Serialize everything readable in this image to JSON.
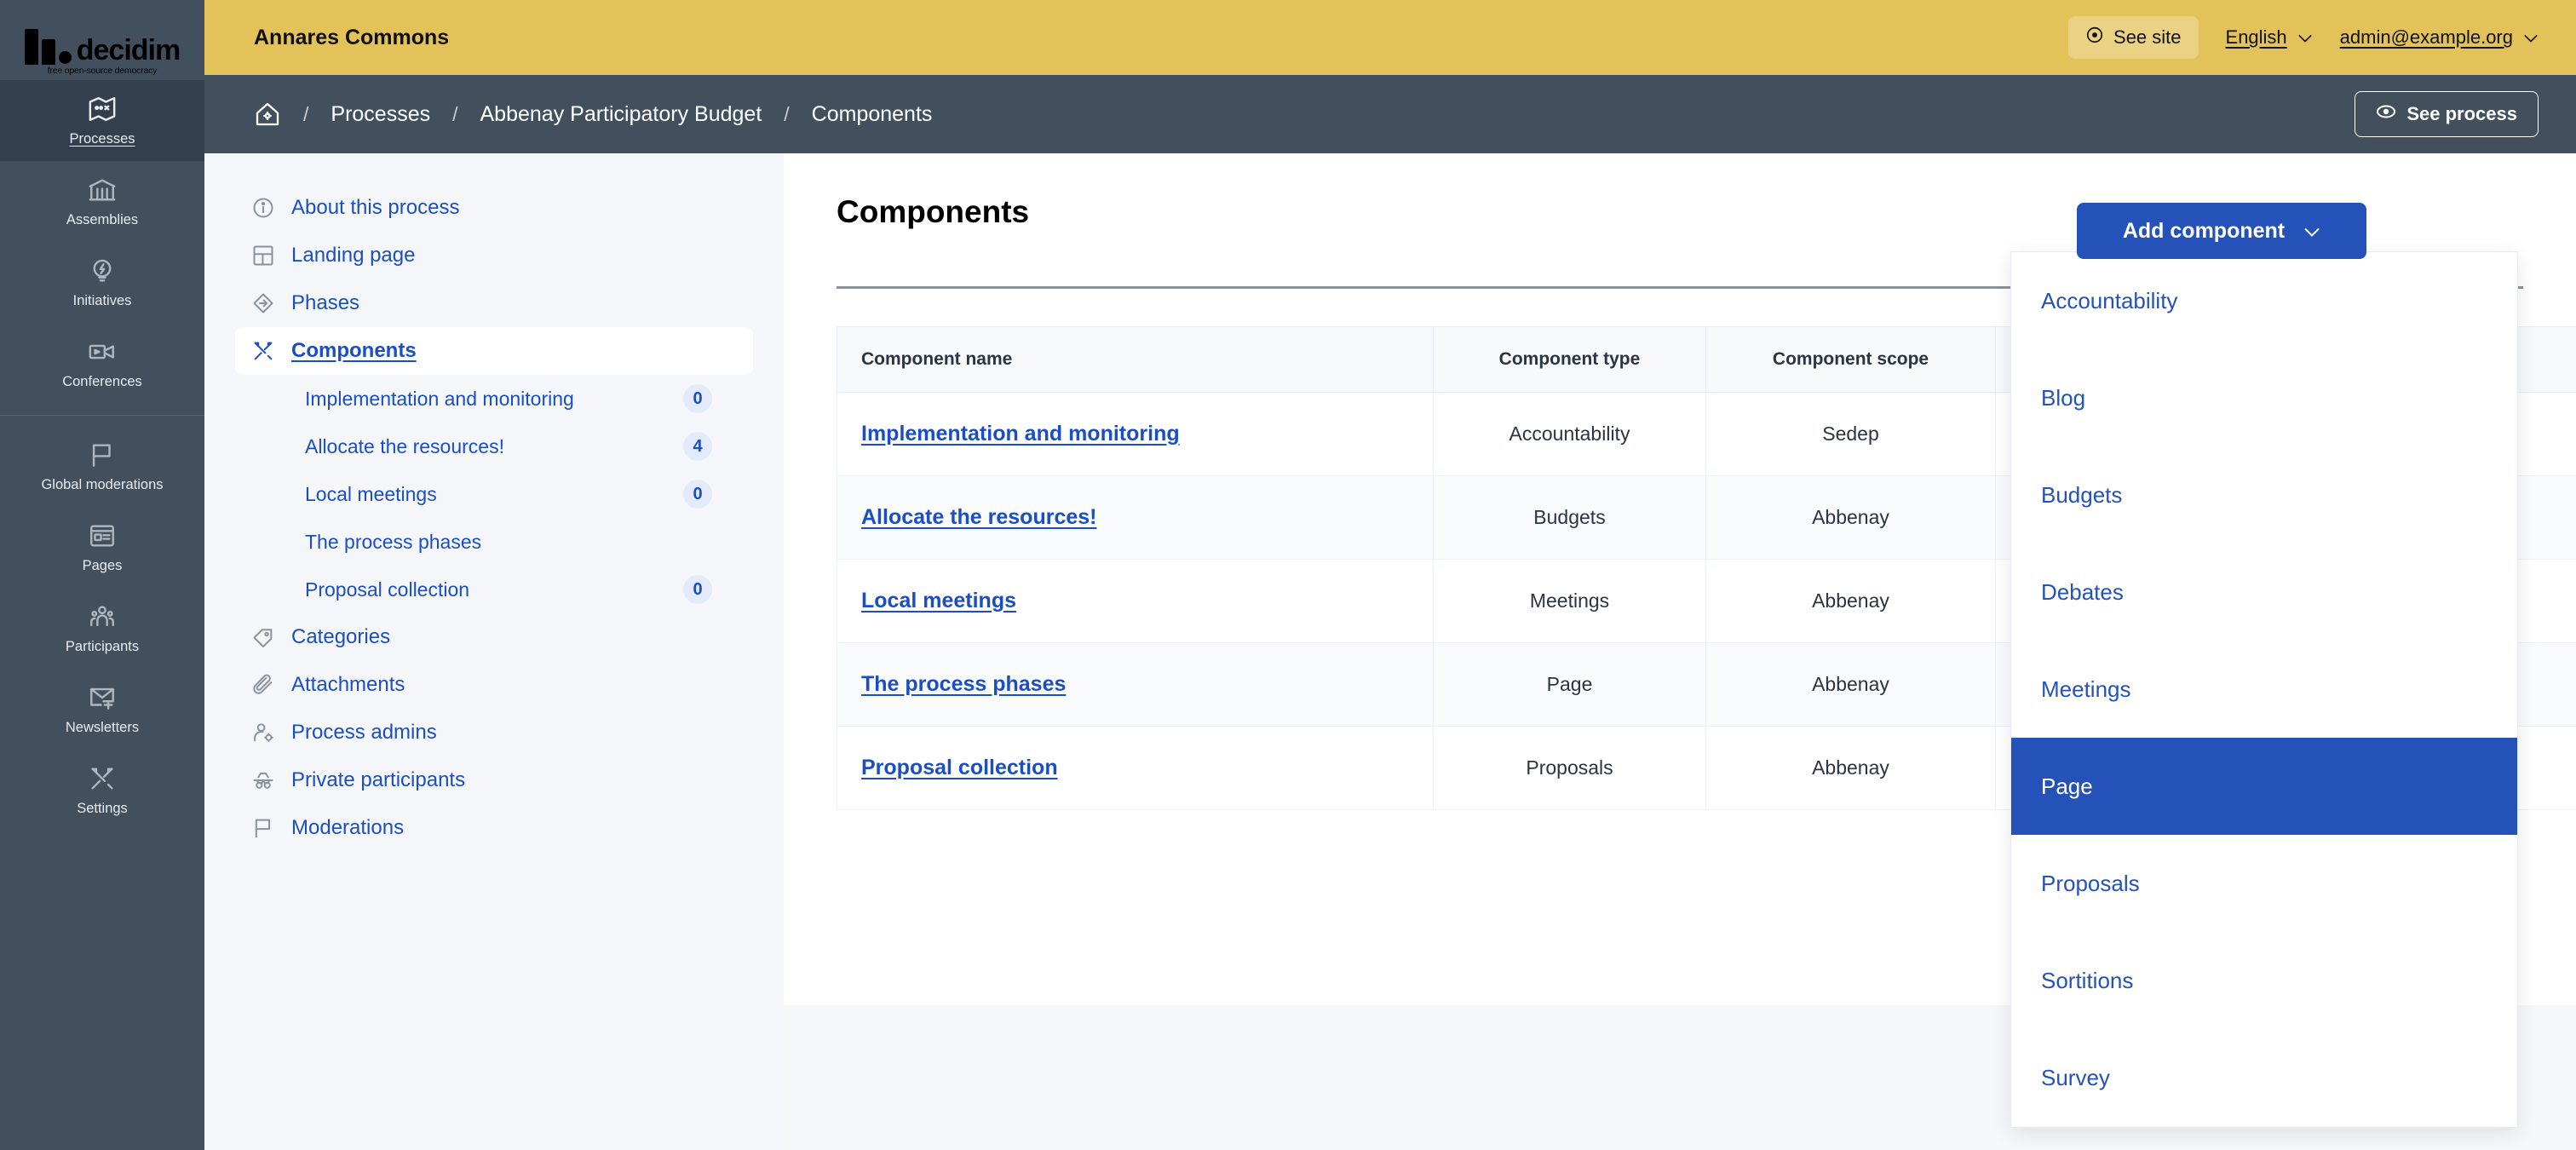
{
  "brand": {
    "logo_word": "decidim",
    "logo_tagline": "free open-source democracy"
  },
  "topbar": {
    "organization_title": "Annares Commons",
    "see_site_label": "See site",
    "see_site_icon": "eye-icon",
    "language_label": "English",
    "language_caret_icon": "chevron-down-icon",
    "account_label": "admin@example.org",
    "account_caret_icon": "chevron-down-icon"
  },
  "breadcrumb": {
    "home_icon": "home-icon",
    "separator": "/",
    "items": [
      {
        "label": "Processes"
      },
      {
        "label": "Abbenay Participatory Budget"
      },
      {
        "label": "Components"
      }
    ],
    "see_process_label": "See process",
    "see_process_icon": "eye-icon"
  },
  "admin_rail": {
    "groups": [
      {
        "items": [
          {
            "label": "Processes",
            "icon": "map-icon",
            "active": true
          },
          {
            "label": "Assemblies",
            "icon": "government-icon",
            "active": false
          },
          {
            "label": "Initiatives",
            "icon": "lightbulb-icon",
            "active": false
          },
          {
            "label": "Conferences",
            "icon": "video-camera-icon",
            "active": false
          }
        ]
      },
      {
        "items": [
          {
            "label": "Global moderations",
            "icon": "flag-icon",
            "active": false
          },
          {
            "label": "Pages",
            "icon": "article-icon",
            "active": false
          },
          {
            "label": "Participants",
            "icon": "people-icon",
            "active": false
          },
          {
            "label": "Newsletters",
            "icon": "mail-add-icon",
            "active": false
          },
          {
            "label": "Settings",
            "icon": "tools-icon",
            "active": false
          }
        ]
      }
    ]
  },
  "process_nav": {
    "items": [
      {
        "label": "About this process",
        "icon": "info-circle-icon",
        "current": false
      },
      {
        "label": "Landing page",
        "icon": "layout-grid-icon",
        "current": false
      },
      {
        "label": "Phases",
        "icon": "diamond-arrow-icon",
        "current": false
      },
      {
        "label": "Components",
        "icon": "tools-icon",
        "current": true
      }
    ],
    "sub_items": [
      {
        "label": "Implementation and monitoring",
        "count": "0",
        "has_count": true
      },
      {
        "label": "Allocate the resources!",
        "count": "4",
        "has_count": true
      },
      {
        "label": "Local meetings",
        "count": "0",
        "has_count": true
      },
      {
        "label": "The process phases",
        "count": "",
        "has_count": false
      },
      {
        "label": "Proposal collection",
        "count": "0",
        "has_count": true
      }
    ],
    "tail_items": [
      {
        "label": "Categories",
        "icon": "tag-icon"
      },
      {
        "label": "Attachments",
        "icon": "paperclip-icon"
      },
      {
        "label": "Process admins",
        "icon": "user-settings-icon"
      },
      {
        "label": "Private participants",
        "icon": "spy-icon"
      },
      {
        "label": "Moderations",
        "icon": "flag-icon"
      }
    ]
  },
  "main": {
    "title": "Components",
    "add_component_label": "Add component",
    "add_component_caret_icon": "chevron-down-icon",
    "table": {
      "headers": [
        "Component name",
        "Component type",
        "Component scope",
        ""
      ],
      "rows": [
        {
          "name": "Implementation and monitoring",
          "type": "Accountability",
          "scope": "Sedep"
        },
        {
          "name": "Allocate the resources!",
          "type": "Budgets",
          "scope": "Abbenay"
        },
        {
          "name": "Local meetings",
          "type": "Meetings",
          "scope": "Abbenay"
        },
        {
          "name": "The process phases",
          "type": "Page",
          "scope": "Abbenay"
        },
        {
          "name": "Proposal collection",
          "type": "Proposals",
          "scope": "Abbenay"
        }
      ]
    }
  },
  "component_menu": {
    "items": [
      {
        "label": "Accountability",
        "selected": false
      },
      {
        "label": "Blog",
        "selected": false
      },
      {
        "label": "Budgets",
        "selected": false
      },
      {
        "label": "Debates",
        "selected": false
      },
      {
        "label": "Meetings",
        "selected": false
      },
      {
        "label": "Page",
        "selected": true
      },
      {
        "label": "Proposals",
        "selected": false
      },
      {
        "label": "Sortitions",
        "selected": false
      },
      {
        "label": "Survey",
        "selected": false
      }
    ]
  },
  "colors": {
    "organization_bar": "#e3c259",
    "chrome_dark": "#42505e",
    "rail_active": "#333f4d",
    "primary_blue": "#2452b8",
    "link_blue": "#1b4ec2",
    "panel_bg": "#f4f6f9"
  }
}
